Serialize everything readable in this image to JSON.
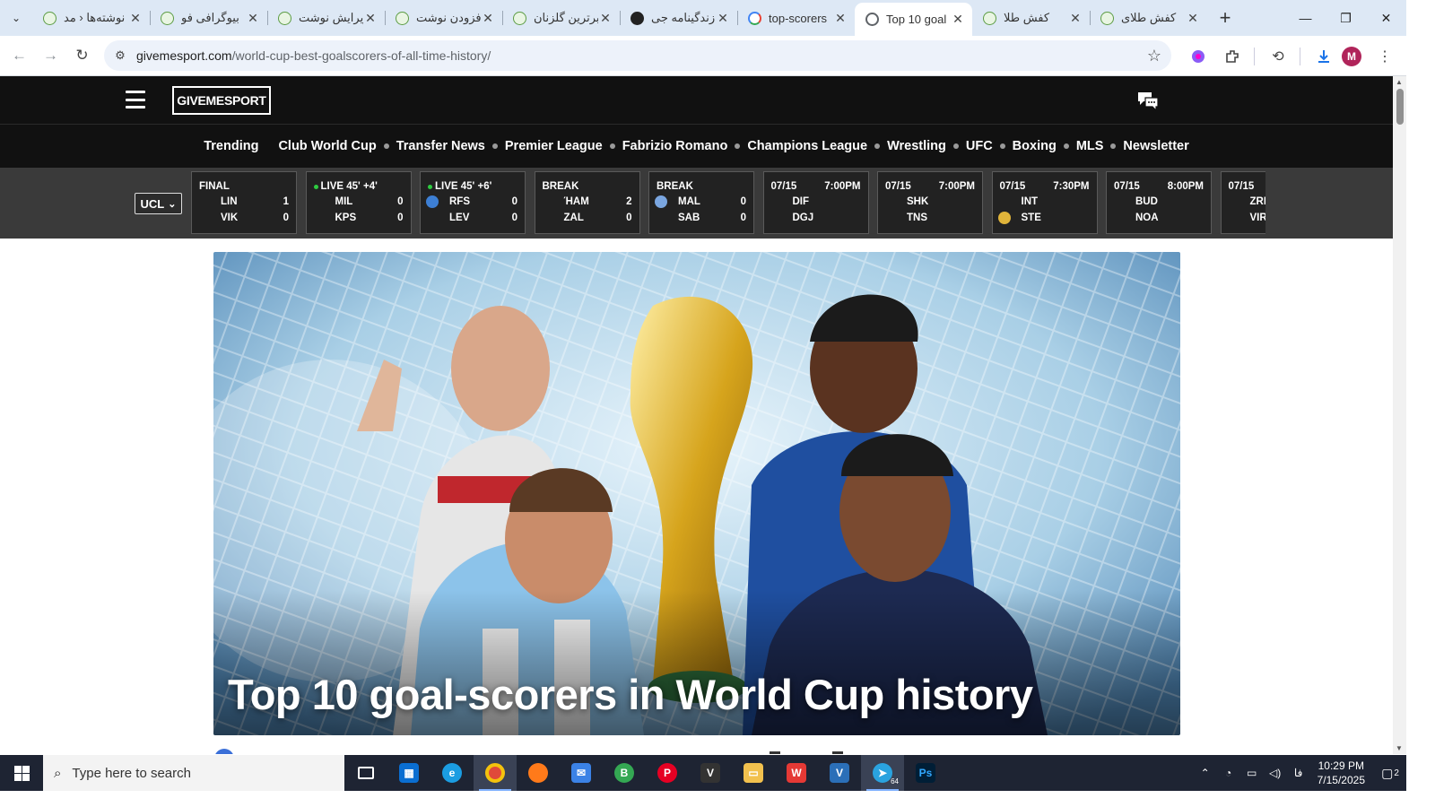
{
  "browser": {
    "tabs": [
      {
        "title": "نوشته‌ها ‹ مد",
        "favicon": "green-leaf-icon",
        "active": false
      },
      {
        "title": "بیوگرافی فو",
        "favicon": "green-leaf-icon",
        "active": false
      },
      {
        "title": "ویرایش نوشت",
        "favicon": "green-leaf-icon",
        "active": false
      },
      {
        "title": "افزودن نوشت",
        "favicon": "green-leaf-icon",
        "active": false
      },
      {
        "title": "برترین گلزنان",
        "favicon": "green-leaf-icon",
        "active": false
      },
      {
        "title": "زندگینامه جی",
        "favicon": "dark-circle-icon",
        "active": false
      },
      {
        "title": "top-scorers",
        "favicon": "google-icon",
        "active": false
      },
      {
        "title": "Top 10 goal",
        "favicon": "globe-icon",
        "active": true
      },
      {
        "title": "کفش طلا",
        "favicon": "green-leaf-icon",
        "active": false
      },
      {
        "title": "کفش طلای",
        "favicon": "green-leaf-icon",
        "active": false
      }
    ],
    "url_domain": "givemesport.com",
    "url_path": "/world-cup-best-goalscorers-of-all-time-history/",
    "profile_initial": "M"
  },
  "site": {
    "logo": "GIVEMESPORT",
    "trending_label": "Trending",
    "nav_items": [
      "Club World Cup",
      "Transfer News",
      "Premier League",
      "Fabrizio Romano",
      "Champions League",
      "Wrestling",
      "UFC",
      "Boxing",
      "MLS",
      "Newsletter"
    ],
    "league_select": "UCL"
  },
  "scores": [
    {
      "status": "FINAL",
      "time": "",
      "live": false,
      "teams": [
        {
          "abbr": "LIN",
          "score": "1"
        },
        {
          "abbr": "VIK",
          "score": "0"
        }
      ]
    },
    {
      "status": "LIVE 45' +4'",
      "time": "",
      "live": true,
      "teams": [
        {
          "abbr": "MIL",
          "score": "0"
        },
        {
          "abbr": "KPS",
          "score": "0"
        }
      ]
    },
    {
      "status": "LIVE 45' +6'",
      "time": "",
      "live": true,
      "teams": [
        {
          "abbr": "RFS",
          "score": "0",
          "badge": "#3d7fd4"
        },
        {
          "abbr": "LEV",
          "score": "0"
        }
      ]
    },
    {
      "status": "BREAK",
      "time": "",
      "live": false,
      "teams": [
        {
          "abbr": "ΉAM",
          "score": "2"
        },
        {
          "abbr": "ZAL",
          "score": "0"
        }
      ]
    },
    {
      "status": "BREAK",
      "time": "",
      "live": false,
      "teams": [
        {
          "abbr": "MAL",
          "score": "0",
          "badge": "#7aa6e0"
        },
        {
          "abbr": "SAB",
          "score": "0"
        }
      ]
    },
    {
      "status": "07/15",
      "time": "7:00PM",
      "live": false,
      "teams": [
        {
          "abbr": "DIF",
          "score": ""
        },
        {
          "abbr": "DGJ",
          "score": ""
        }
      ]
    },
    {
      "status": "07/15",
      "time": "7:00PM",
      "live": false,
      "teams": [
        {
          "abbr": "SHK",
          "score": ""
        },
        {
          "abbr": "TNS",
          "score": ""
        }
      ]
    },
    {
      "status": "07/15",
      "time": "7:30PM",
      "live": false,
      "teams": [
        {
          "abbr": "INT",
          "score": ""
        },
        {
          "abbr": "STE",
          "score": "",
          "badge": "#e0b43a"
        }
      ]
    },
    {
      "status": "07/15",
      "time": "8:00PM",
      "live": false,
      "teams": [
        {
          "abbr": "BUD",
          "score": ""
        },
        {
          "abbr": "NOA",
          "score": ""
        }
      ]
    },
    {
      "status": "07/15",
      "time": "",
      "live": false,
      "teams": [
        {
          "abbr": "ZRI",
          "score": ""
        },
        {
          "abbr": "VIR",
          "score": ""
        }
      ]
    }
  ],
  "article": {
    "hero_title": "Top 10 goal-scorers in World Cup history"
  },
  "taskbar": {
    "search_placeholder": "Type here to search",
    "apps": [
      "task-view-icon",
      "store-icon",
      "edge-icon",
      "chrome-icon",
      "firefox-icon",
      "mail-icon",
      "chrome-b-icon",
      "pinterest-icon",
      "vpn-icon",
      "file-explorer-icon",
      "wps-icon",
      "v2ray-icon",
      "telegram-icon",
      "photoshop-icon"
    ],
    "telegram_badge": "64",
    "time": "10:29 PM",
    "date": "7/15/2025",
    "lang": "فا",
    "notifications": "2"
  },
  "colors": {
    "site_header": "#111111",
    "score_strip": "#3a3a3a",
    "live_dot": "#2ecc40",
    "tabstrip": "#dde8f5",
    "taskbar": "#1e2433"
  }
}
